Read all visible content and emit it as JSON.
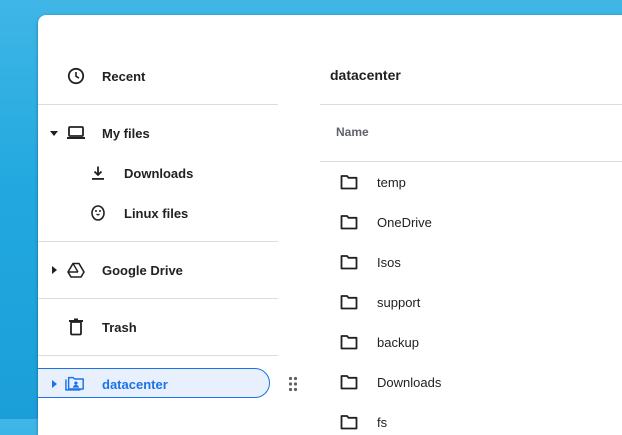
{
  "sidebar": {
    "items": [
      {
        "label": "Recent",
        "icon": "clock-icon"
      },
      {
        "label": "My files",
        "icon": "laptop-icon"
      },
      {
        "label": "Downloads",
        "icon": "download-icon"
      },
      {
        "label": "Linux files",
        "icon": "penguin-icon"
      },
      {
        "label": "Google Drive",
        "icon": "drive-icon"
      },
      {
        "label": "Trash",
        "icon": "trash-icon"
      },
      {
        "label": "datacenter",
        "icon": "shared-folder-icon"
      }
    ]
  },
  "main": {
    "breadcrumb": "datacenter",
    "column_header": "Name",
    "files": [
      "temp",
      "OneDrive",
      "Isos",
      "support",
      "backup",
      "Downloads",
      "fs"
    ]
  },
  "colors": {
    "accent": "#1a73e8",
    "selected_bg": "#e8f0fe",
    "icon": "#202124",
    "divider": "#dadce0"
  }
}
